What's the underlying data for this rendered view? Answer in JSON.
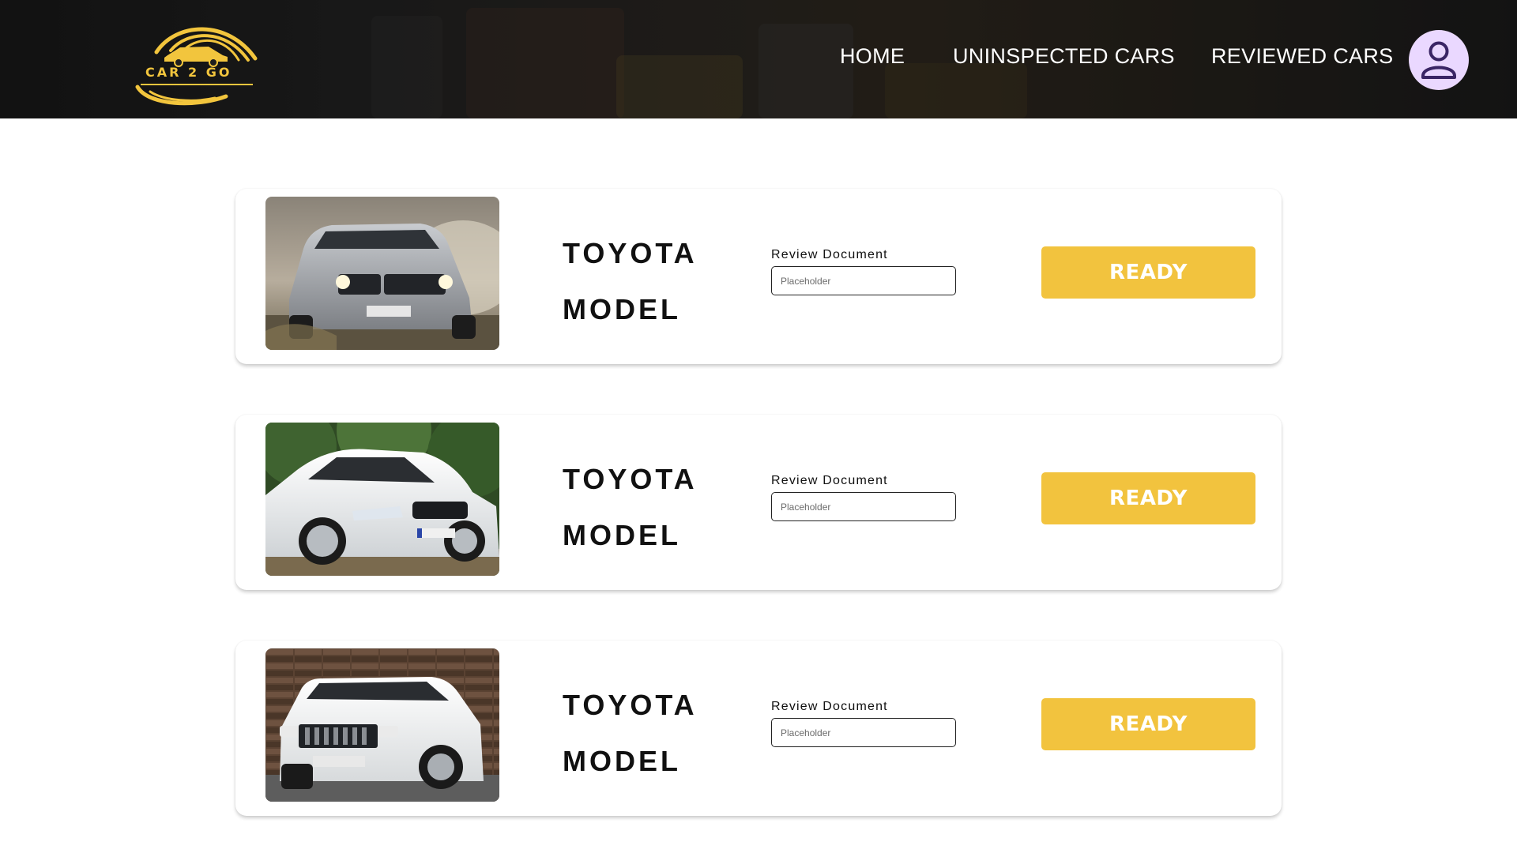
{
  "brand": {
    "logo_text": "CAR 2 GO",
    "accent_color": "#f2c33e"
  },
  "nav": {
    "home": "HOME",
    "uninspected": "UNINSPECTED CARS",
    "reviewed": "REVIEWED CARS"
  },
  "user": {
    "avatar_icon": "user-icon"
  },
  "cars": [
    {
      "name_line1": "TOYOTA",
      "name_line2": "MODEL",
      "review_label": "Review Document",
      "review_placeholder": "Placeholder",
      "review_value": "",
      "button_label": "READY",
      "photo": "silver-suv-photo"
    },
    {
      "name_line1": "TOYOTA",
      "name_line2": "MODEL",
      "review_label": "Review Document",
      "review_placeholder": "Placeholder",
      "review_value": "",
      "button_label": "READY",
      "photo": "white-sedan-photo"
    },
    {
      "name_line1": "TOYOTA",
      "name_line2": "MODEL",
      "review_label": "Review Document",
      "review_placeholder": "Placeholder",
      "review_value": "",
      "button_label": "READY",
      "photo": "white-jeep-photo"
    }
  ]
}
